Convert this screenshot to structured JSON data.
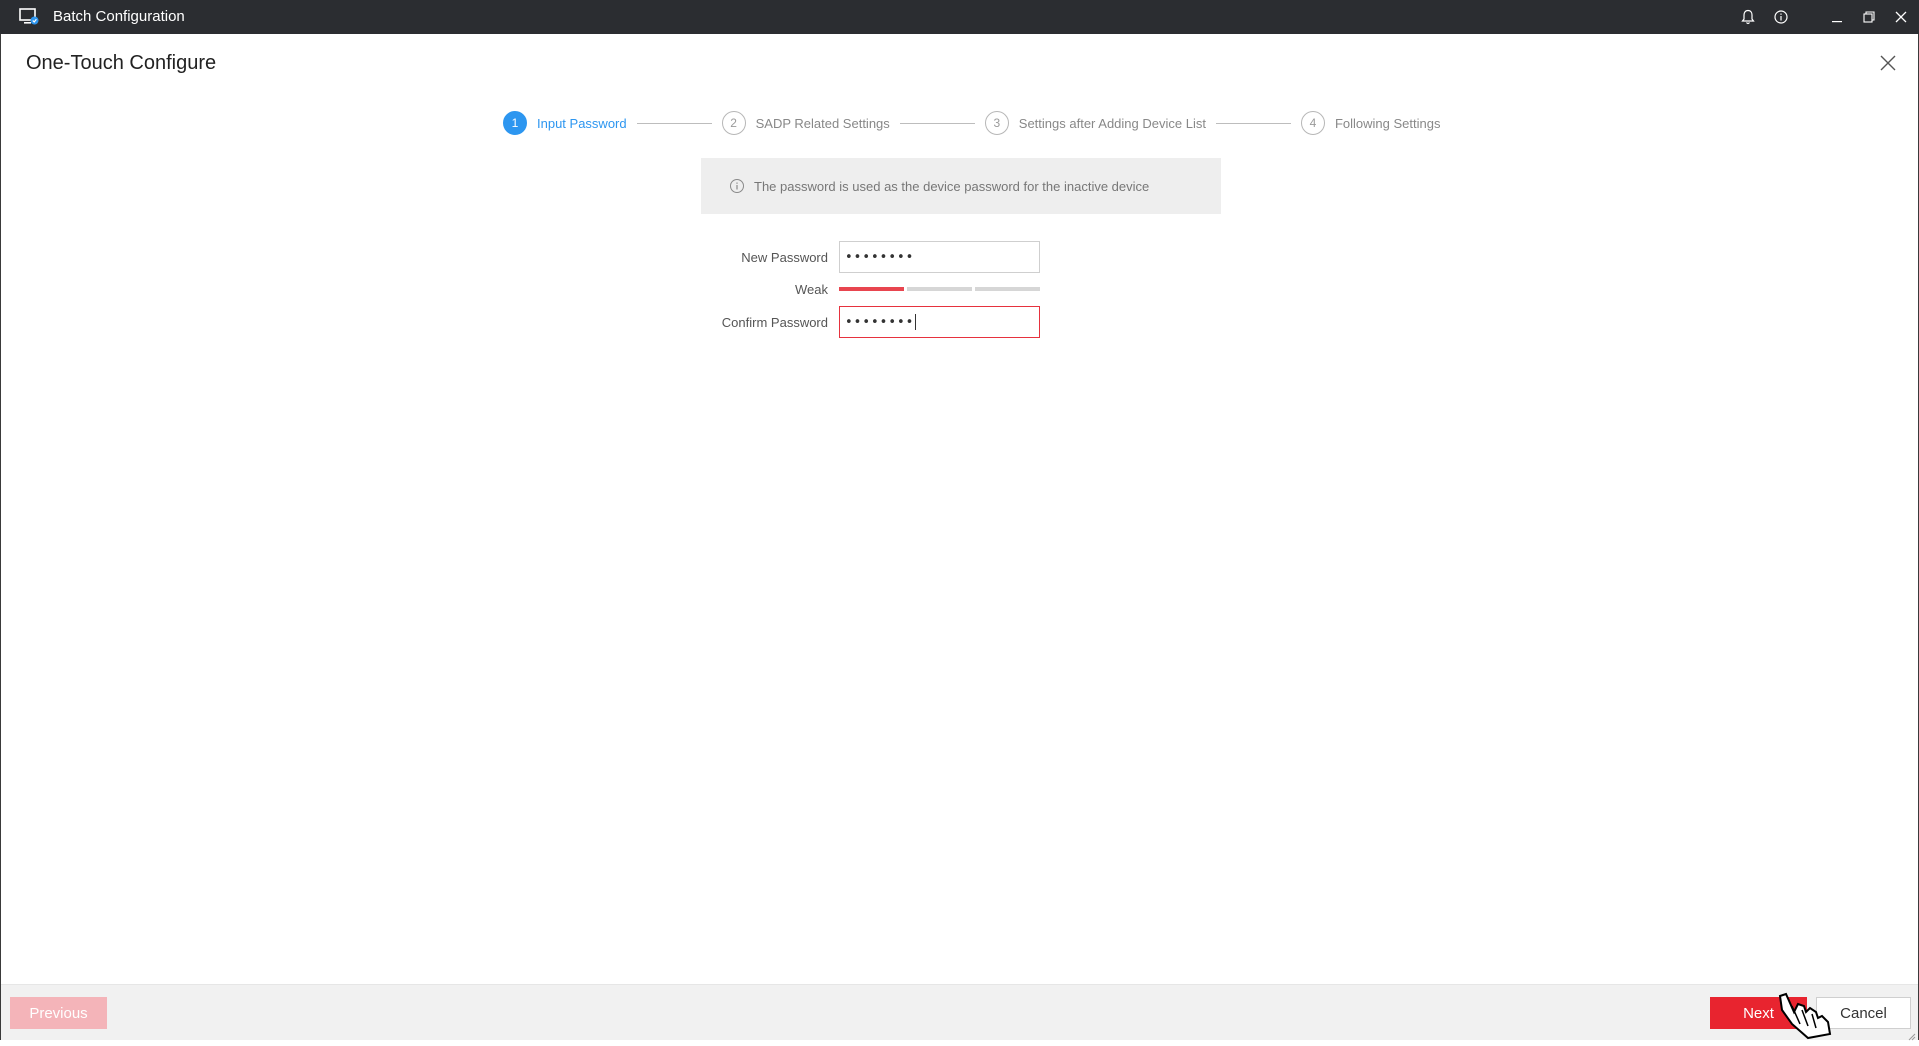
{
  "window": {
    "title": "Batch Configuration",
    "icons": [
      "app-icon",
      "bell-icon",
      "info-icon",
      "minimize-icon",
      "restore-icon",
      "close-icon"
    ]
  },
  "dialog": {
    "title": "One-Touch Configure"
  },
  "stepper": {
    "steps": [
      {
        "number": "1",
        "label": "Input Password",
        "active": true
      },
      {
        "number": "2",
        "label": "SADP Related Settings",
        "active": false
      },
      {
        "number": "3",
        "label": "Settings after Adding Device List",
        "active": false
      },
      {
        "number": "4",
        "label": "Following Settings",
        "active": false
      }
    ]
  },
  "info": {
    "text": "The password is used as the device password for the inactive device"
  },
  "form": {
    "new_password_label": "New Password",
    "new_password_value": "••••••••",
    "strength_label": "Weak",
    "strength_level": "1 of 3",
    "confirm_password_label": "Confirm Password",
    "confirm_password_value": "••••••••"
  },
  "footer": {
    "previous_label": "Previous",
    "next_label": "Next",
    "cancel_label": "Cancel"
  },
  "colors": {
    "accent_blue": "#2d96f0",
    "danger_red": "#e8242f",
    "titlebar": "#2b2d31"
  }
}
